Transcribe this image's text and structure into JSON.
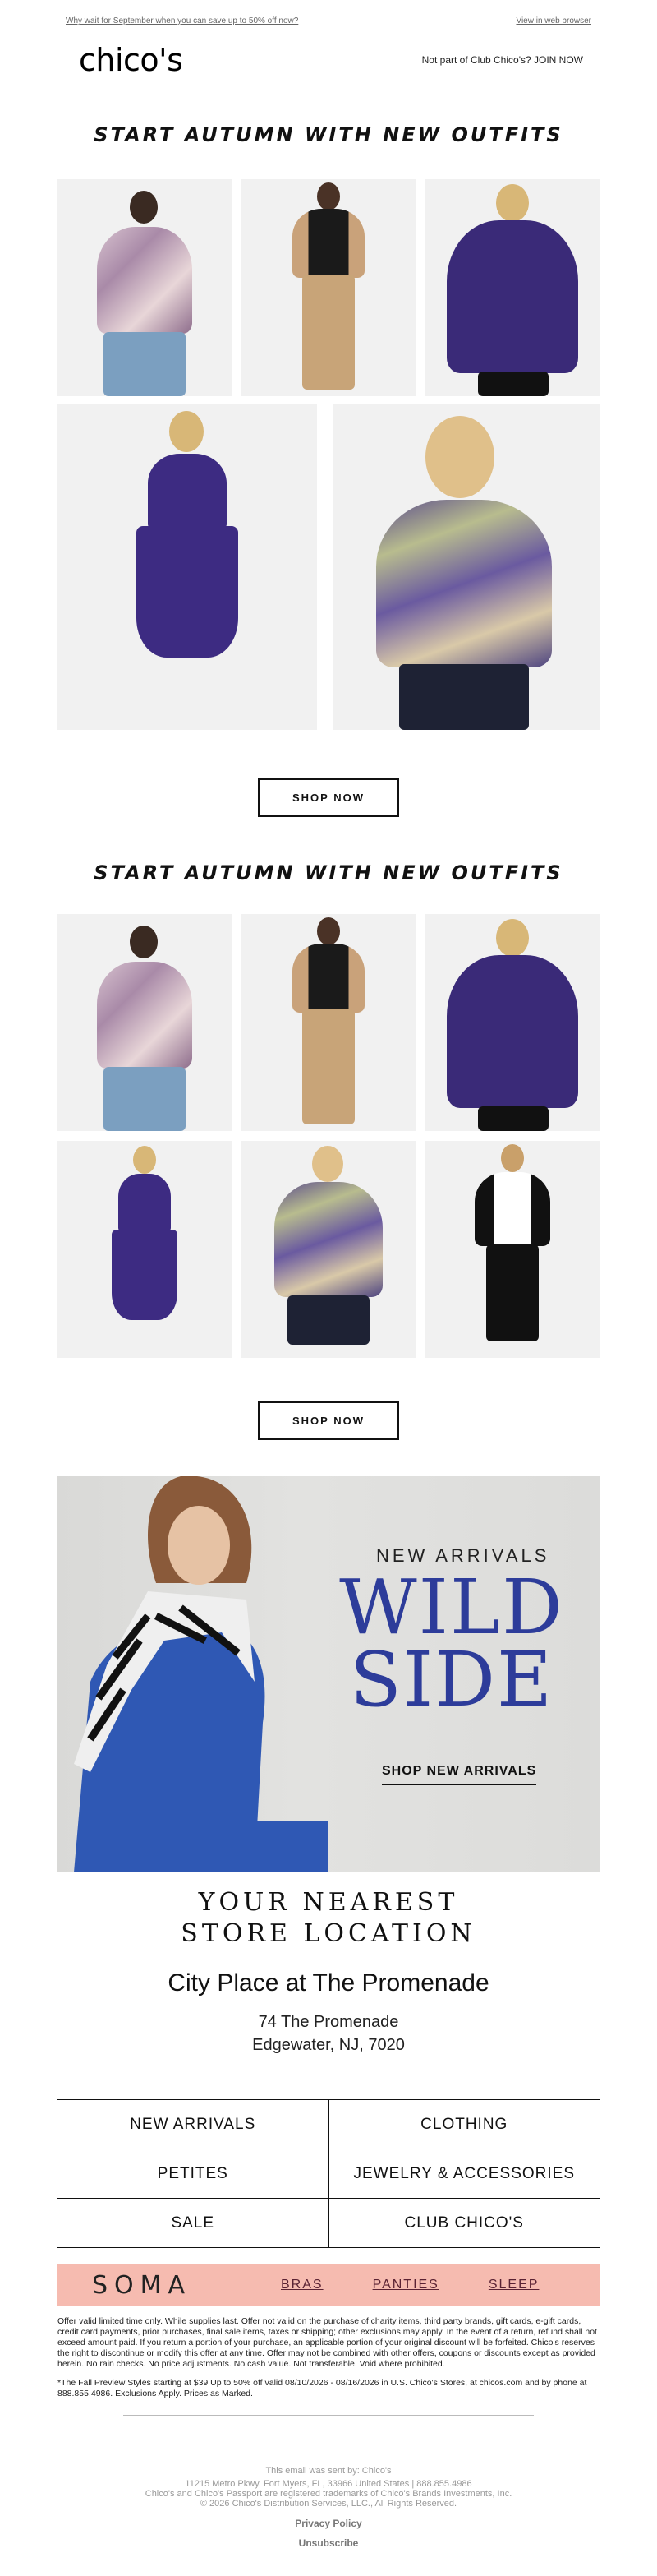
{
  "preheader": {
    "left_text": "Why wait for September when you can save up to 50% off now?",
    "right_text": "View in web browser"
  },
  "header": {
    "logo": "chico's",
    "club_text": "Not part of Club Chico's? JOIN NOW"
  },
  "section1": {
    "title": "START AUTUMN WITH NEW OUTFITS",
    "button": "SHOP NOW"
  },
  "section2": {
    "title": "START AUTUMN WITH NEW OUTFITS",
    "button": "SHOP NOW"
  },
  "banner": {
    "eyebrow": "NEW ARRIVALS",
    "headline_line1": "WILD",
    "headline_line2": "SIDE",
    "cta": "SHOP NEW ARRIVALS",
    "accent_color": "#2d3c9a"
  },
  "store": {
    "title_line1": "YOUR NEAREST",
    "title_line2": "STORE LOCATION",
    "name": "City Place at The Promenade",
    "address_line1": "74 The Promenade",
    "address_line2": "Edgewater, NJ, 7020"
  },
  "nav": {
    "rows": [
      [
        "NEW ARRIVALS",
        "CLOTHING"
      ],
      [
        "PETITES",
        "JEWELRY & ACCESSORIES"
      ],
      [
        "SALE",
        "CLUB CHICO'S"
      ]
    ]
  },
  "soma": {
    "brand": "SOMA",
    "links": [
      "BRAS",
      "PANTIES",
      "SLEEP"
    ],
    "bg_color": "#f6bbb0"
  },
  "legal": {
    "paragraph1": "Offer valid limited time only. While supplies last. Offer not valid on the purchase of charity items, third party brands, gift cards, e-gift cards, credit card payments, prior purchases, final sale items, taxes or shipping; other exclusions may apply. In the event of a return, refund shall not exceed amount paid. If you return a portion of your purchase, an applicable portion of your original discount will be forfeited. Chico's reserves the right to discontinue or modify this offer at any time. Offer may not be combined with other offers, coupons or discounts except as provided herein. No rain checks. No price adjustments. No cash value. Not transferable. Void where prohibited.",
    "paragraph2": "*The Fall Preview Styles starting at $39 Up to 50% off valid 08/10/2026 - 08/16/2026 in U.S. Chico's Stores, at chicos.com and by phone at 888.855.4986. Exclusions Apply. Prices as Marked."
  },
  "footer": {
    "line1": "This email was sent by: Chico's",
    "line2": "11215 Metro Pkwy, Fort Myers, FL, 33966 United States | 888.855.4986",
    "line3": "Chico's and Chico's Passport are registered trademarks of Chico's Brands Investments, Inc.",
    "line4": "© 2026 Chico's Distribution Services, LLC., All Rights Reserved.",
    "privacy": "Privacy Policy",
    "unsubscribe": "Unsubscribe"
  }
}
